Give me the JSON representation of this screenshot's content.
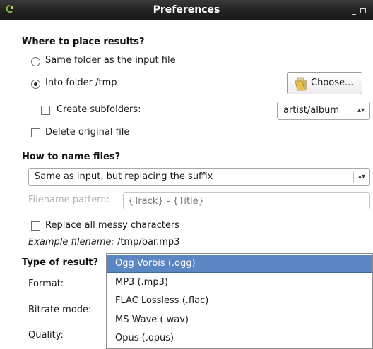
{
  "window": {
    "title": "Preferences"
  },
  "place": {
    "heading": "Where to place results?",
    "same_folder_label": "Same folder as the input file",
    "into_folder_label": "Into folder /tmp",
    "choose_label": "Choose...",
    "create_subfolders_label": "Create subfolders:",
    "subfolder_pattern_value": "artist/album",
    "delete_original_label": "Delete original file"
  },
  "naming": {
    "heading": "How to name files?",
    "scheme_value": "Same as input, but replacing the suffix",
    "pattern_label": "Filename pattern:",
    "pattern_placeholder": "{Track} - {Title}",
    "replace_messy_label": "Replace all messy characters",
    "example_prefix": "Example filename:",
    "example_value": "/tmp/bar.mp3"
  },
  "result": {
    "heading": "Type of result?",
    "format_label": "Format:",
    "bitrate_label": "Bitrate mode:",
    "quality_label": "Quality:",
    "format_options": [
      "Ogg Vorbis (.ogg)",
      "MP3 (.mp3)",
      "FLAC Lossless (.flac)",
      "MS Wave (.wav)",
      "Opus (.opus)"
    ]
  },
  "icons": {
    "app": "app-icon",
    "choose": "folder-icon"
  },
  "colors": {
    "titlebar": "#222222",
    "selection": "#5b86c4",
    "icon_accent": "#7cbf3a"
  }
}
